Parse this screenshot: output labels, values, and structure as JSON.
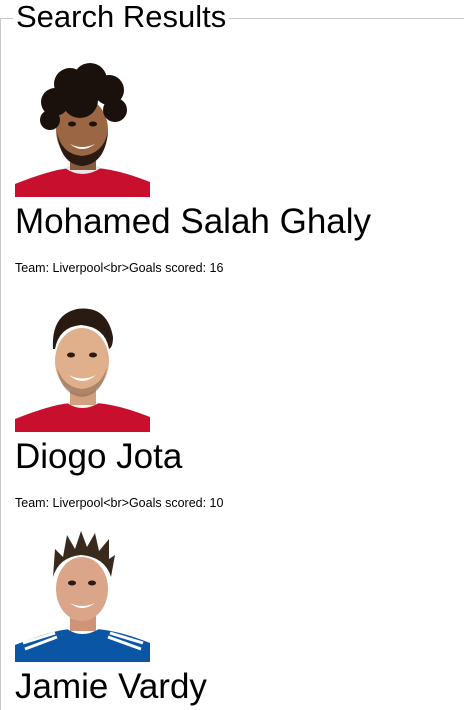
{
  "page": {
    "heading": "Search Results"
  },
  "results": [
    {
      "name": "Mohamed Salah Ghaly",
      "info": "Team: Liverpool<br>Goals scored: 16",
      "photo_icon": "player-photo-salah",
      "kit_color": "#c8102e"
    },
    {
      "name": "Diogo Jota",
      "info": "Team: Liverpool<br>Goals scored: 10",
      "photo_icon": "player-photo-jota",
      "kit_color": "#c8102e"
    },
    {
      "name": "Jamie Vardy",
      "photo_icon": "player-photo-vardy",
      "kit_color": "#0b56a4"
    }
  ]
}
